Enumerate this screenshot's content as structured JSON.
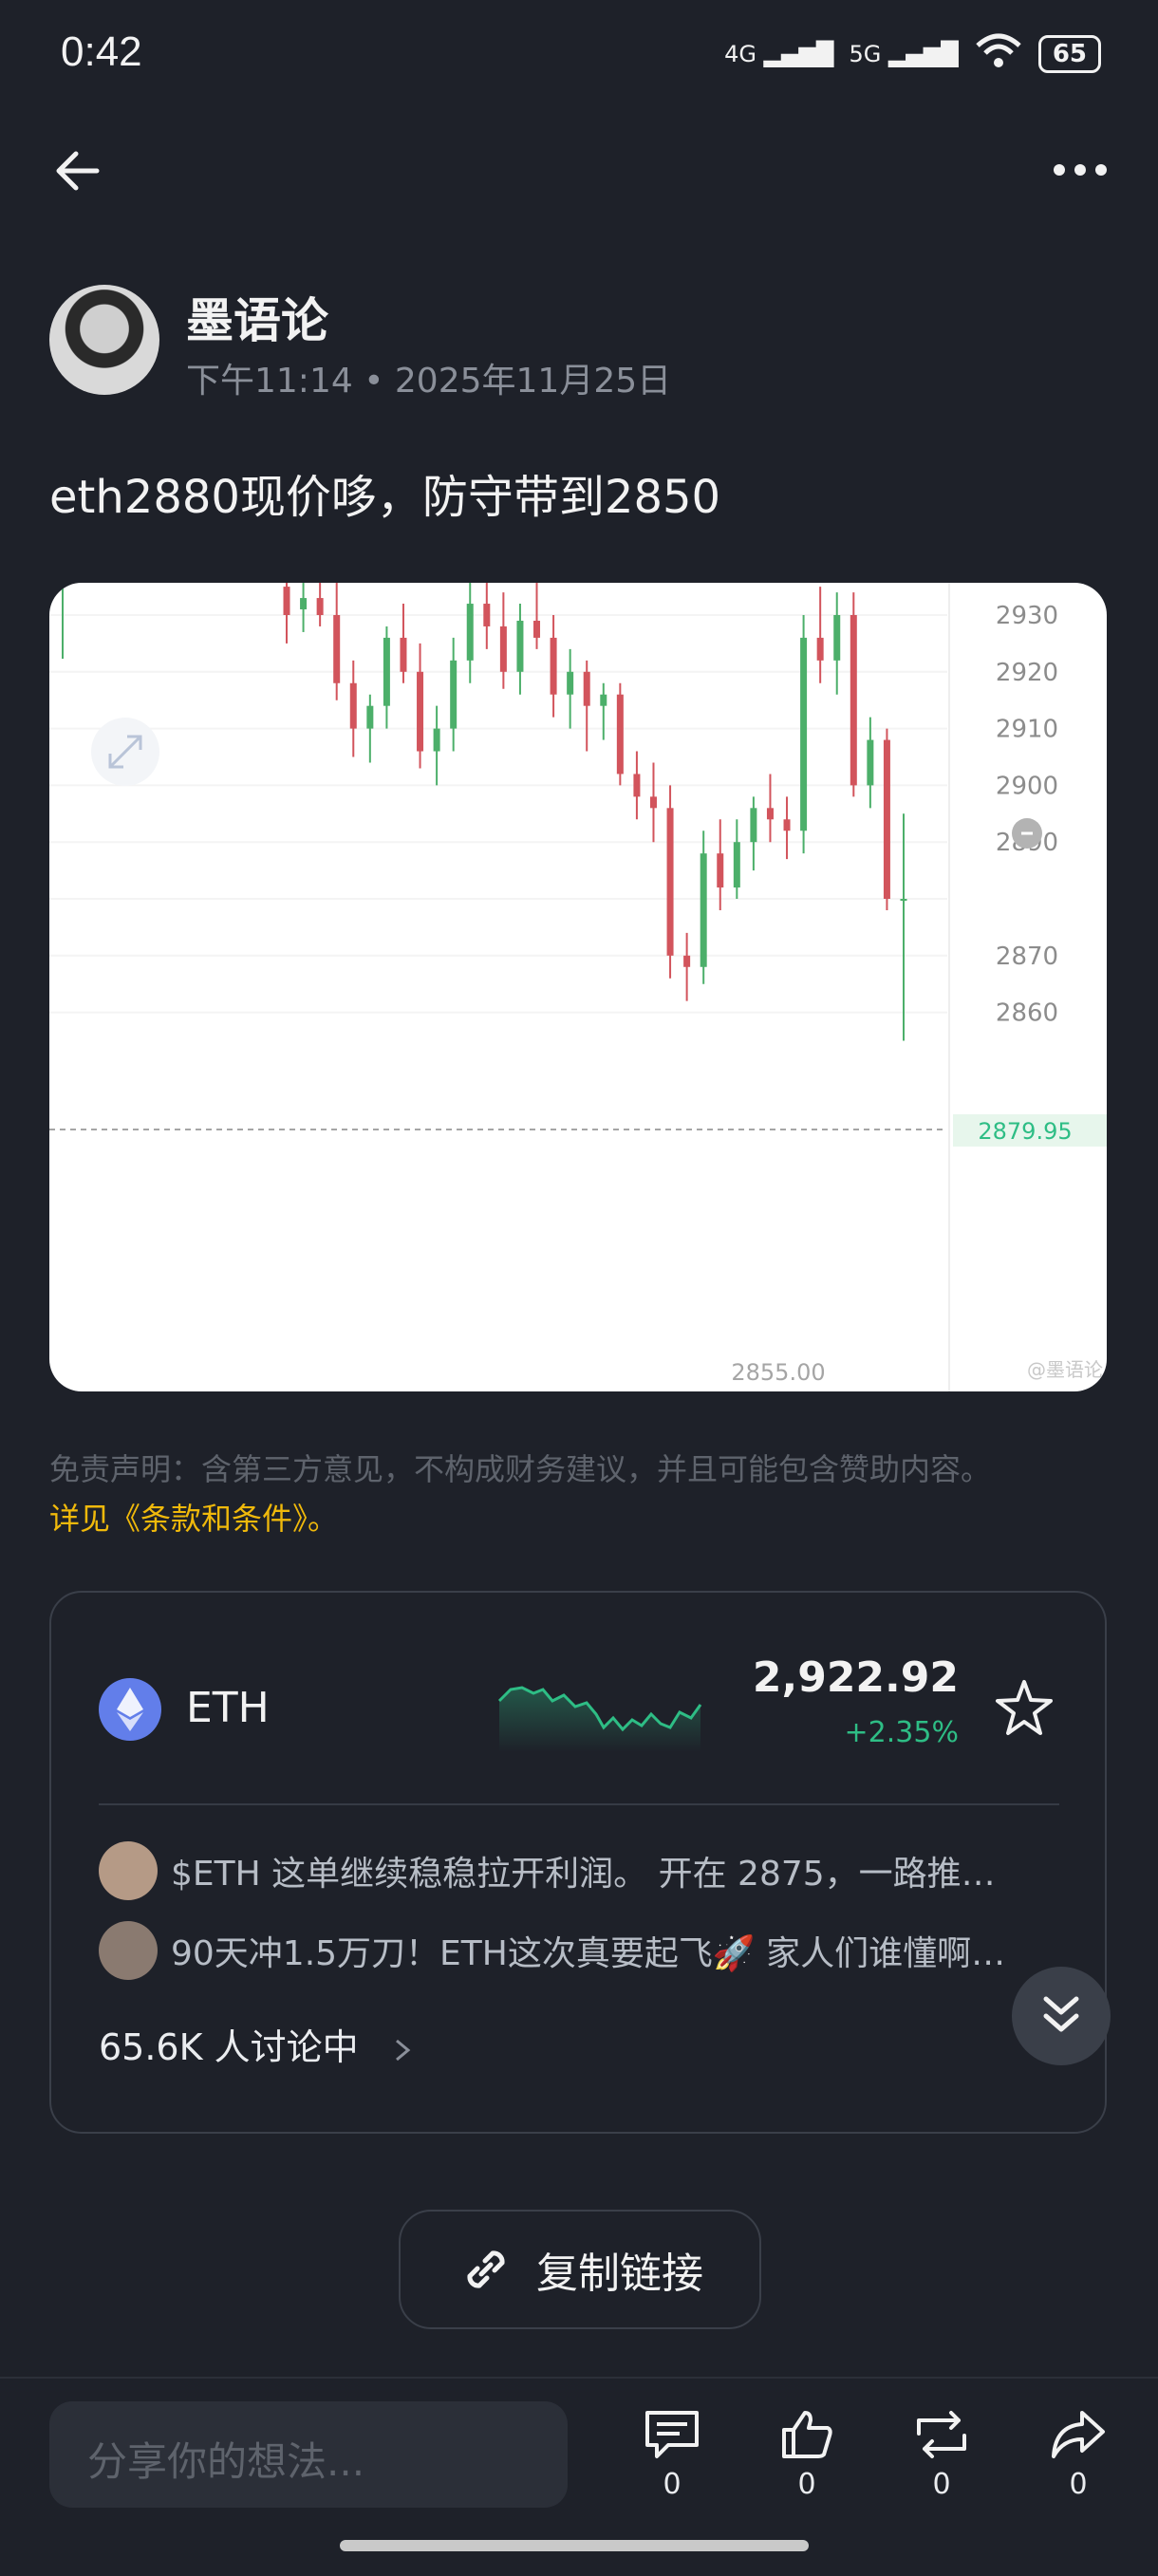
{
  "status_bar": {
    "time": "0:42",
    "network1": "4G",
    "network2": "5G",
    "battery": "65"
  },
  "post": {
    "author": "墨语论",
    "time": "下午11:14",
    "date": "2025年11月25日",
    "text": "eth2880现价哆，防守带到2850"
  },
  "chart_image": {
    "y_ticks": [
      "2930",
      "2920",
      "2910",
      "2900",
      "2890",
      "2870",
      "2860"
    ],
    "current_price_label": "2879.95",
    "low_label": "2855.00",
    "watermark": "@墨语论",
    "colors": {
      "up": "#4caf6a",
      "down": "#d2545c",
      "price_line": "#a5a5a5",
      "price_label_bg": "#e7f6ec",
      "price_label_text": "#2ebd85"
    }
  },
  "chart_data": {
    "type": "candlestick",
    "ylim": [
      2853,
      2936
    ],
    "y_ticks": [
      2930,
      2920,
      2910,
      2900,
      2890,
      2880,
      2870,
      2860
    ],
    "current_price": 2879.95,
    "marked_low": 2855.0,
    "candles_ohlc": [
      [
        2935,
        2936,
        2925,
        2930
      ],
      [
        2931,
        2936,
        2927,
        2933
      ],
      [
        2933,
        2936,
        2928,
        2930
      ],
      [
        2930,
        2936,
        2915,
        2918
      ],
      [
        2918,
        2922,
        2905,
        2910
      ],
      [
        2910,
        2916,
        2904,
        2914
      ],
      [
        2914,
        2928,
        2910,
        2926
      ],
      [
        2926,
        2932,
        2918,
        2920
      ],
      [
        2920,
        2925,
        2903,
        2906
      ],
      [
        2906,
        2914,
        2900,
        2910
      ],
      [
        2910,
        2926,
        2906,
        2922
      ],
      [
        2922,
        2936,
        2918,
        2932
      ],
      [
        2932,
        2936,
        2924,
        2928
      ],
      [
        2928,
        2934,
        2917,
        2920
      ],
      [
        2920,
        2932,
        2916,
        2929
      ],
      [
        2929,
        2936,
        2924,
        2926
      ],
      [
        2926,
        2930,
        2912,
        2916
      ],
      [
        2916,
        2924,
        2910,
        2920
      ],
      [
        2920,
        2922,
        2906,
        2914
      ],
      [
        2914,
        2918,
        2908,
        2916
      ],
      [
        2916,
        2918,
        2900,
        2902
      ],
      [
        2902,
        2906,
        2894,
        2898
      ],
      [
        2898,
        2904,
        2890,
        2896
      ],
      [
        2896,
        2900,
        2866,
        2870
      ],
      [
        2870,
        2874,
        2862,
        2868
      ],
      [
        2868,
        2892,
        2865,
        2888
      ],
      [
        2888,
        2894,
        2878,
        2882
      ],
      [
        2882,
        2894,
        2880,
        2890
      ],
      [
        2890,
        2898,
        2885,
        2896
      ],
      [
        2896,
        2902,
        2890,
        2894
      ],
      [
        2894,
        2898,
        2887,
        2892
      ],
      [
        2892,
        2930,
        2888,
        2926
      ],
      [
        2926,
        2935,
        2918,
        2922
      ],
      [
        2922,
        2934,
        2916,
        2930
      ],
      [
        2930,
        2934,
        2898,
        2900
      ],
      [
        2900,
        2912,
        2896,
        2908
      ],
      [
        2908,
        2910,
        2878,
        2880
      ],
      [
        2880,
        2895,
        2855,
        2880
      ]
    ]
  },
  "disclaimer": {
    "text": "免责声明：含第三方意见，不构成财务建议，并且可能包含赞助内容。",
    "link": "详见《条款和条件》。"
  },
  "coin_card": {
    "symbol": "ETH",
    "price": "2,922.92",
    "change": "+2.35%",
    "discussions": [
      "$ETH 这单继续稳稳拉开利润。 开在 2875，一路推…",
      "90天冲1.5万刀！ETH这次真要起飞🚀 家人们谁懂啊…"
    ],
    "discuss_count": "65.6K 人讨论中",
    "colors": {
      "positive": "#2ebd85",
      "eth_logo": "#627eea"
    }
  },
  "copy_link": {
    "label": "复制链接"
  },
  "bottom_bar": {
    "input_placeholder": "分享你的想法...",
    "comments": "0",
    "likes": "0",
    "reposts": "0",
    "shares": "0"
  }
}
